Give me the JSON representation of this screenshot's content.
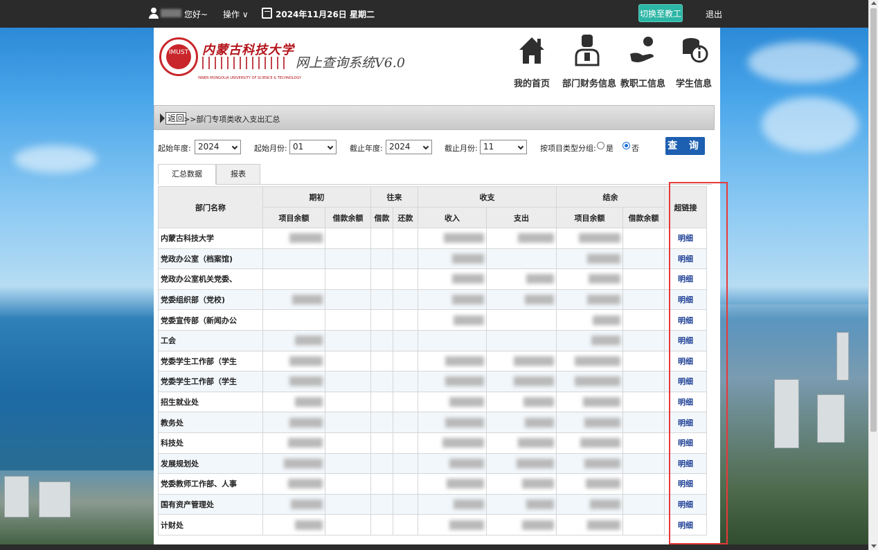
{
  "topbar": {
    "greeting": "您好~",
    "ops": "操作 ∨",
    "date": "2024年11月26日 星期二",
    "switch_label": "切换至教工",
    "logout": "退出"
  },
  "header": {
    "brand_cn": "内蒙古科技大学",
    "brand_en": "INNER MONGOLIA UNIVERSITY OF SCIENCE & TECHNOLOGY",
    "system_title": "网上查询系统V6.0",
    "nav": [
      {
        "label": "我的首页",
        "icon": "home-icon"
      },
      {
        "label": "部门财务信息",
        "icon": "person-icon"
      },
      {
        "label": "教职工信息",
        "icon": "hand-coin-icon"
      },
      {
        "label": "学生信息",
        "icon": "coins-info-icon"
      }
    ]
  },
  "breadcrumb": {
    "back": "返回",
    "path": ">>部门专项类收入支出汇总"
  },
  "filters": {
    "start_year_label": "起始年度:",
    "start_year": "2024",
    "start_month_label": "起始月份:",
    "start_month": "01",
    "end_year_label": "截止年度:",
    "end_year": "2024",
    "end_month_label": "截止月份:",
    "end_month": "11",
    "group_label": "按项目类型分组:",
    "yes": "是",
    "no": "否",
    "query": "查 询"
  },
  "tabs": [
    "汇总数据",
    "报表"
  ],
  "table": {
    "head": {
      "dept": "部门名称",
      "opening": "期初",
      "transfer": "往来",
      "income_expense": "收支",
      "balance": "结余",
      "link": "超链接",
      "sub": [
        "项目余额",
        "借款余额",
        "借款",
        "还款",
        "收入",
        "支出",
        "项目余额",
        "借款余额"
      ]
    },
    "link_text": "明细",
    "rows": [
      "内蒙古科技大学",
      "党政办公室（档案馆)",
      "党政办公室机关党委、",
      "党委组织部（党校)",
      "党委宣传部（新闻办公",
      "工会",
      "党委学生工作部（学生",
      "党委学生工作部（学生",
      "招生就业处",
      "教务处",
      "科技处",
      "发展规划处",
      "党委教师工作部、人事",
      "国有资产管理处",
      "计财处"
    ]
  }
}
